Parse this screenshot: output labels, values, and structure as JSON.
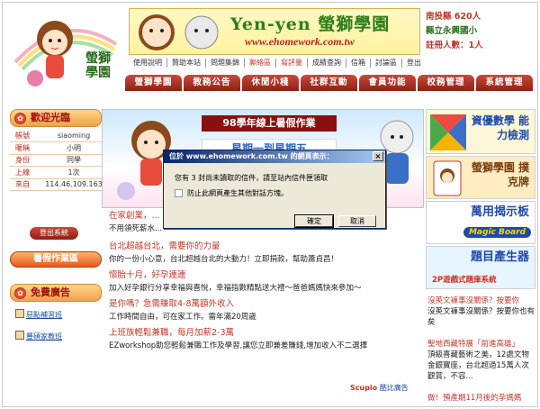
{
  "header": {
    "site_title": "Yen-yen 螢獅學園",
    "url": "www.ehomework.com.tw",
    "logo_text": "螢獅學園"
  },
  "stats": {
    "county_line": "南投縣  620人",
    "school": "縣立永興國小",
    "registered": "註冊人數：1人"
  },
  "topnav": [
    "使用說明",
    "贊助本站",
    "問題集錦",
    "聯絡區",
    "寫評量",
    "成績查詢",
    "信箱",
    "討論區",
    "登出"
  ],
  "mainnav": [
    "螢獅學園",
    "教務公告",
    "休閒小棧",
    "社群互動",
    "會員功能",
    "校務管理",
    "系統管理"
  ],
  "welcome": {
    "heading": "歡迎光臨",
    "rows": [
      {
        "k": "帳號",
        "v": "siaoming"
      },
      {
        "k": "暱稱",
        "v": "小明"
      },
      {
        "k": "身份",
        "v": "同學"
      },
      {
        "k": "上線",
        "v": "1次"
      },
      {
        "k": "來自",
        "v": "114.46.109.163"
      }
    ],
    "logout": "登出系統"
  },
  "summer_button": "暑假作業區",
  "free_ads": {
    "heading": "免費廣告",
    "items": [
      "惡點補習班",
      "豐碩家教班"
    ]
  },
  "center_banner": {
    "title": "98學年線上暑假作業",
    "subtitle": "星期一到星期五"
  },
  "news": [
    {
      "title": "在家創業，...",
      "desc": "不用領死薪水..."
    },
    {
      "title": "台北超越台北，需要你的力量",
      "desc": "你的一份小心意，台北超越台北的大動力！立即捐款，幫助蕭貞昌！"
    },
    {
      "title": "懷胎十月，好孕連連",
      "desc": "加入好孕銀行分享幸福與喜悅，幸福指數精點送大禮～爸爸媽媽快來參加～"
    },
    {
      "title": "是你嗎？急需賺取4-8萬額外收入",
      "desc": "工作時間自由，可在家工作。需年滿20周歲"
    },
    {
      "title": "上班族輕鬆兼職，每月加薪2-3萬",
      "desc": "EZworkshop助您輕鬆兼職工作及學習,讓您立即兼差賺錢,增加收入不二選擇"
    }
  ],
  "scupio": {
    "brand": "Scupio",
    "label": "酷比廣告"
  },
  "right_ads": {
    "ad1": "資優數學 能力檢測",
    "ad2": "螢獅學園 撲克牌",
    "ad3": "萬用揭示板",
    "ad3_sub": "Magic Board",
    "ad4": "題目產生器",
    "ad4_sub": "2P遊戲式題庫系統"
  },
  "right_links": [
    {
      "link": "沒英文褲事沒關係？按要你",
      "text": "沒英文褲事沒關係？按要你也有矣"
    },
    {
      "link": "聖地西藏特展「前進高雄」",
      "text": "頂級喜藏藝術之美，12處文物金銀寶座，台北超過15萬人次觀賞，不容..."
    },
    {
      "link": "做！預產期11月後的孕媽媽",
      "text": ""
    }
  ],
  "dialog": {
    "title": "位於 www.ehomework.com.tw 的網頁表示：",
    "message": "您有 3 封尚未讀取的信件，請至站內信件匣領取",
    "checkbox_label": "防止此網頁產生其他對話方塊。",
    "ok": "確定",
    "cancel": "取消",
    "close": "×"
  }
}
